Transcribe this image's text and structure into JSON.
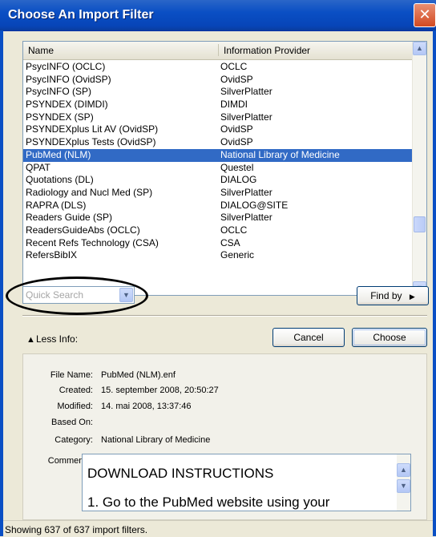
{
  "window": {
    "title": "Choose An Import Filter",
    "close_glyph": "✕"
  },
  "list": {
    "columns": [
      "Name",
      "Information Provider"
    ],
    "rows": [
      {
        "name": "PsycINFO (OCLC)",
        "provider": "OCLC"
      },
      {
        "name": "PsycINFO (OvidSP)",
        "provider": "OvidSP"
      },
      {
        "name": "PsycINFO (SP)",
        "provider": "SilverPlatter"
      },
      {
        "name": "PSYNDEX (DIMDI)",
        "provider": "DIMDI"
      },
      {
        "name": "PSYNDEX (SP)",
        "provider": "SilverPlatter"
      },
      {
        "name": "PSYNDEXplus Lit AV (OvidSP)",
        "provider": "OvidSP"
      },
      {
        "name": "PSYNDEXplus Tests (OvidSP)",
        "provider": "OvidSP"
      },
      {
        "name": "PubMed (NLM)",
        "provider": "National Library of Medicine"
      },
      {
        "name": "QPAT",
        "provider": "Questel"
      },
      {
        "name": "Quotations (DL)",
        "provider": "DIALOG"
      },
      {
        "name": "Radiology and Nucl Med (SP)",
        "provider": "SilverPlatter"
      },
      {
        "name": "RAPRA (DLS)",
        "provider": "DIALOG@SITE"
      },
      {
        "name": "Readers Guide (SP)",
        "provider": "SilverPlatter"
      },
      {
        "name": "ReadersGuideAbs (OCLC)",
        "provider": "OCLC"
      },
      {
        "name": "Recent Refs Technology (CSA)",
        "provider": "CSA"
      },
      {
        "name": "RefersBibIX",
        "provider": "Generic"
      }
    ],
    "selected_index": 7
  },
  "quick_search": {
    "placeholder": "Quick Search"
  },
  "buttons": {
    "find_by": "Find by",
    "cancel": "Cancel",
    "choose": "Choose"
  },
  "less_info": "Less Info:",
  "info": {
    "file_name": {
      "label": "File Name:",
      "value": "PubMed (NLM).enf"
    },
    "created": {
      "label": "Created:",
      "value": "15. september 2008, 20:50:27"
    },
    "modified": {
      "label": "Modified:",
      "value": "14. mai 2008, 13:37:46"
    },
    "based_on": {
      "label": "Based On:",
      "value": ""
    },
    "category": {
      "label": "Category:",
      "value": "National Library of Medicine"
    },
    "comments": {
      "label": "Comments:",
      "line1": "DOWNLOAD INSTRUCTIONS",
      "line2": "1. Go to the PubMed website using your"
    }
  },
  "status": "Showing 637 of 637 import filters."
}
